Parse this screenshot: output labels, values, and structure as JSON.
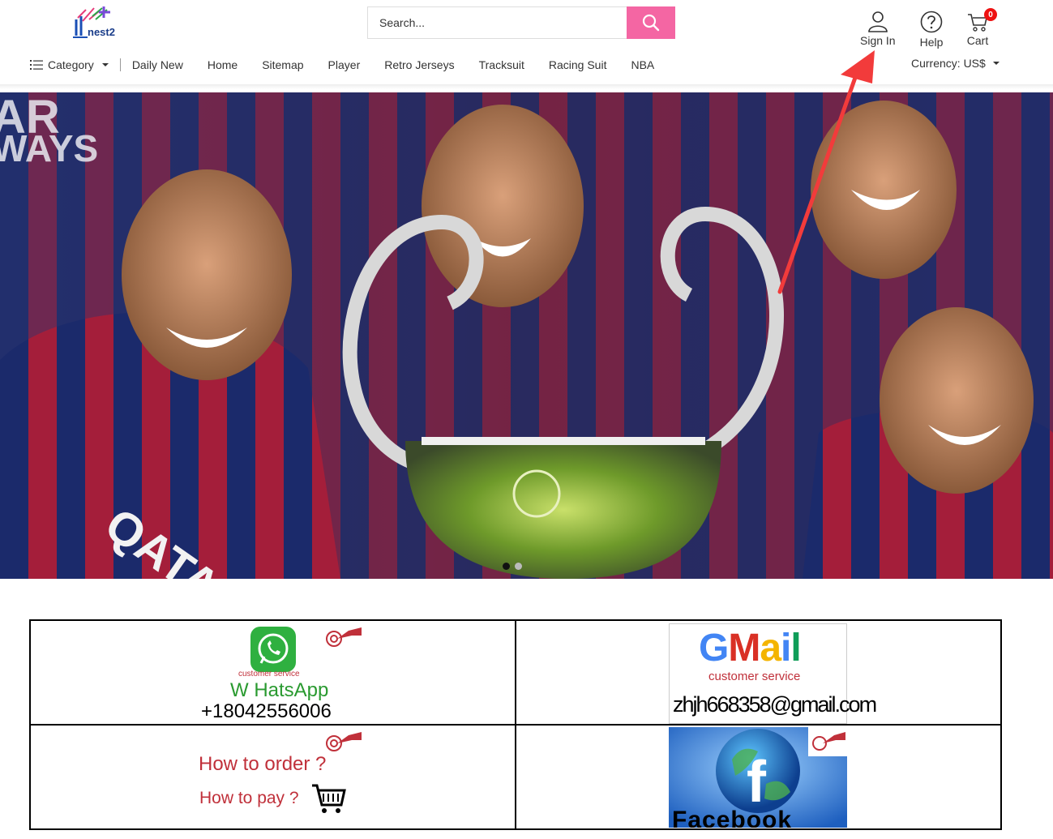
{
  "header": {
    "logo_text": "nest2",
    "search_placeholder": "Search...",
    "sign_in": "Sign In",
    "help": "Help",
    "cart": "Cart",
    "cart_count": "0",
    "icons": [
      "user-icon",
      "help-icon",
      "cart-icon",
      "search-icon"
    ]
  },
  "nav": {
    "category": "Category",
    "links": [
      "Daily New",
      "Home",
      "Sitemap",
      "Player",
      "Retro Jerseys",
      "Tracksuit",
      "Racing Suit",
      "NBA"
    ],
    "currency": "Currency: US$"
  },
  "banner": {
    "slides": 2,
    "active_slide": 1,
    "colors": {
      "blue": "#1b2a6b",
      "red": "#a41e3a",
      "gold": "#e5b227"
    }
  },
  "contact": {
    "whatsapp": {
      "caption": "customer service",
      "label": "W HatsApp",
      "phone": "+18042556006"
    },
    "gmail": {
      "label": "Gmail",
      "caption": "customer service",
      "email": "zhjh668358@gmail.com"
    },
    "order": {
      "line1": "How to order ?",
      "line2": "How to pay ?"
    },
    "facebook": {
      "label": "Facebook"
    }
  },
  "colors": {
    "accent_pink": "#f466a3",
    "badge_red": "#e11111",
    "annotation_red": "#f23b3b"
  }
}
